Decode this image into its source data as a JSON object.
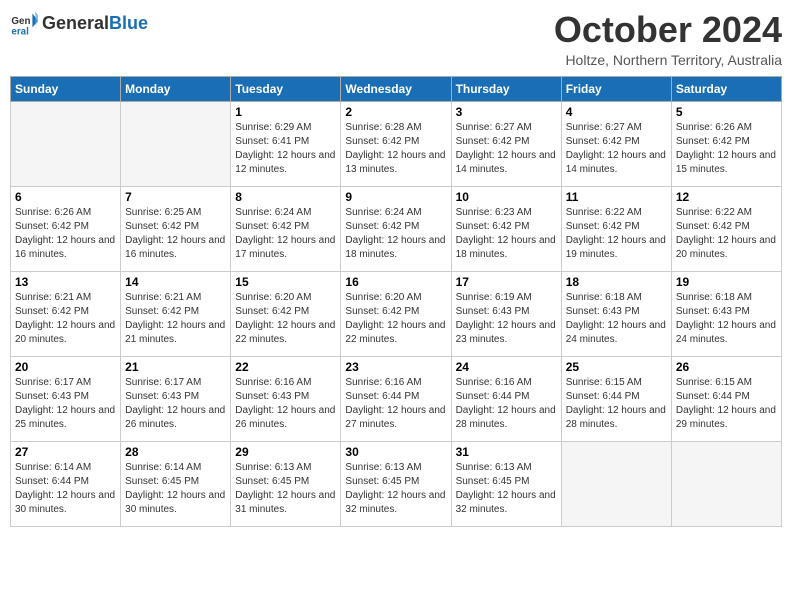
{
  "header": {
    "logo_general": "General",
    "logo_blue": "Blue",
    "month_title": "October 2024",
    "subtitle": "Holtze, Northern Territory, Australia"
  },
  "weekdays": [
    "Sunday",
    "Monday",
    "Tuesday",
    "Wednesday",
    "Thursday",
    "Friday",
    "Saturday"
  ],
  "weeks": [
    [
      {
        "day": "",
        "info": ""
      },
      {
        "day": "",
        "info": ""
      },
      {
        "day": "1",
        "info": "Sunrise: 6:29 AM\nSunset: 6:41 PM\nDaylight: 12 hours and 12 minutes."
      },
      {
        "day": "2",
        "info": "Sunrise: 6:28 AM\nSunset: 6:42 PM\nDaylight: 12 hours and 13 minutes."
      },
      {
        "day": "3",
        "info": "Sunrise: 6:27 AM\nSunset: 6:42 PM\nDaylight: 12 hours and 14 minutes."
      },
      {
        "day": "4",
        "info": "Sunrise: 6:27 AM\nSunset: 6:42 PM\nDaylight: 12 hours and 14 minutes."
      },
      {
        "day": "5",
        "info": "Sunrise: 6:26 AM\nSunset: 6:42 PM\nDaylight: 12 hours and 15 minutes."
      }
    ],
    [
      {
        "day": "6",
        "info": "Sunrise: 6:26 AM\nSunset: 6:42 PM\nDaylight: 12 hours and 16 minutes."
      },
      {
        "day": "7",
        "info": "Sunrise: 6:25 AM\nSunset: 6:42 PM\nDaylight: 12 hours and 16 minutes."
      },
      {
        "day": "8",
        "info": "Sunrise: 6:24 AM\nSunset: 6:42 PM\nDaylight: 12 hours and 17 minutes."
      },
      {
        "day": "9",
        "info": "Sunrise: 6:24 AM\nSunset: 6:42 PM\nDaylight: 12 hours and 18 minutes."
      },
      {
        "day": "10",
        "info": "Sunrise: 6:23 AM\nSunset: 6:42 PM\nDaylight: 12 hours and 18 minutes."
      },
      {
        "day": "11",
        "info": "Sunrise: 6:22 AM\nSunset: 6:42 PM\nDaylight: 12 hours and 19 minutes."
      },
      {
        "day": "12",
        "info": "Sunrise: 6:22 AM\nSunset: 6:42 PM\nDaylight: 12 hours and 20 minutes."
      }
    ],
    [
      {
        "day": "13",
        "info": "Sunrise: 6:21 AM\nSunset: 6:42 PM\nDaylight: 12 hours and 20 minutes."
      },
      {
        "day": "14",
        "info": "Sunrise: 6:21 AM\nSunset: 6:42 PM\nDaylight: 12 hours and 21 minutes."
      },
      {
        "day": "15",
        "info": "Sunrise: 6:20 AM\nSunset: 6:42 PM\nDaylight: 12 hours and 22 minutes."
      },
      {
        "day": "16",
        "info": "Sunrise: 6:20 AM\nSunset: 6:42 PM\nDaylight: 12 hours and 22 minutes."
      },
      {
        "day": "17",
        "info": "Sunrise: 6:19 AM\nSunset: 6:43 PM\nDaylight: 12 hours and 23 minutes."
      },
      {
        "day": "18",
        "info": "Sunrise: 6:18 AM\nSunset: 6:43 PM\nDaylight: 12 hours and 24 minutes."
      },
      {
        "day": "19",
        "info": "Sunrise: 6:18 AM\nSunset: 6:43 PM\nDaylight: 12 hours and 24 minutes."
      }
    ],
    [
      {
        "day": "20",
        "info": "Sunrise: 6:17 AM\nSunset: 6:43 PM\nDaylight: 12 hours and 25 minutes."
      },
      {
        "day": "21",
        "info": "Sunrise: 6:17 AM\nSunset: 6:43 PM\nDaylight: 12 hours and 26 minutes."
      },
      {
        "day": "22",
        "info": "Sunrise: 6:16 AM\nSunset: 6:43 PM\nDaylight: 12 hours and 26 minutes."
      },
      {
        "day": "23",
        "info": "Sunrise: 6:16 AM\nSunset: 6:44 PM\nDaylight: 12 hours and 27 minutes."
      },
      {
        "day": "24",
        "info": "Sunrise: 6:16 AM\nSunset: 6:44 PM\nDaylight: 12 hours and 28 minutes."
      },
      {
        "day": "25",
        "info": "Sunrise: 6:15 AM\nSunset: 6:44 PM\nDaylight: 12 hours and 28 minutes."
      },
      {
        "day": "26",
        "info": "Sunrise: 6:15 AM\nSunset: 6:44 PM\nDaylight: 12 hours and 29 minutes."
      }
    ],
    [
      {
        "day": "27",
        "info": "Sunrise: 6:14 AM\nSunset: 6:44 PM\nDaylight: 12 hours and 30 minutes."
      },
      {
        "day": "28",
        "info": "Sunrise: 6:14 AM\nSunset: 6:45 PM\nDaylight: 12 hours and 30 minutes."
      },
      {
        "day": "29",
        "info": "Sunrise: 6:13 AM\nSunset: 6:45 PM\nDaylight: 12 hours and 31 minutes."
      },
      {
        "day": "30",
        "info": "Sunrise: 6:13 AM\nSunset: 6:45 PM\nDaylight: 12 hours and 32 minutes."
      },
      {
        "day": "31",
        "info": "Sunrise: 6:13 AM\nSunset: 6:45 PM\nDaylight: 12 hours and 32 minutes."
      },
      {
        "day": "",
        "info": ""
      },
      {
        "day": "",
        "info": ""
      }
    ]
  ]
}
